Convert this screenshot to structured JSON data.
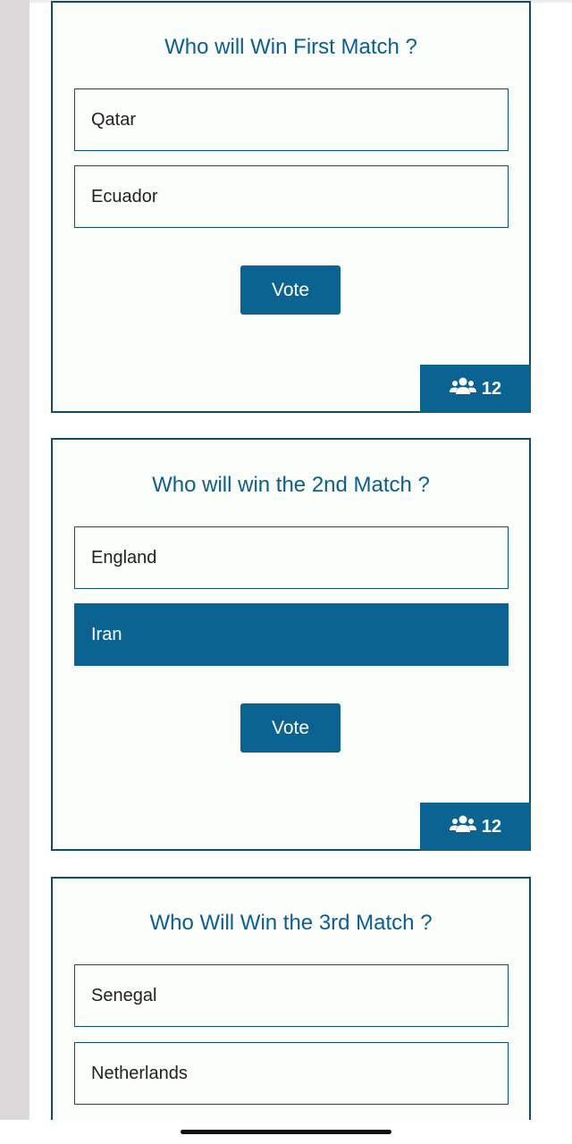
{
  "polls": [
    {
      "question": "Who will Win First Match ?",
      "options": [
        {
          "label": "Qatar",
          "selected": false
        },
        {
          "label": "Ecuador",
          "selected": false
        }
      ],
      "vote_label": "Vote",
      "vote_count": "12",
      "vote_icon": "users-icon"
    },
    {
      "question": "Who will win the 2nd Match ?",
      "options": [
        {
          "label": "England",
          "selected": false
        },
        {
          "label": "Iran",
          "selected": true
        }
      ],
      "vote_label": "Vote",
      "vote_count": "12",
      "vote_icon": "users-icon"
    },
    {
      "question": "Who Will Win the 3rd Match ?",
      "options": [
        {
          "label": "Senegal",
          "selected": false
        },
        {
          "label": "Netherlands",
          "selected": false
        }
      ]
    }
  ],
  "colors": {
    "accent": "#0b6391",
    "title": "#0c5f8c",
    "border": "#0d4e6b",
    "card_bg": "#fbfdfa"
  }
}
